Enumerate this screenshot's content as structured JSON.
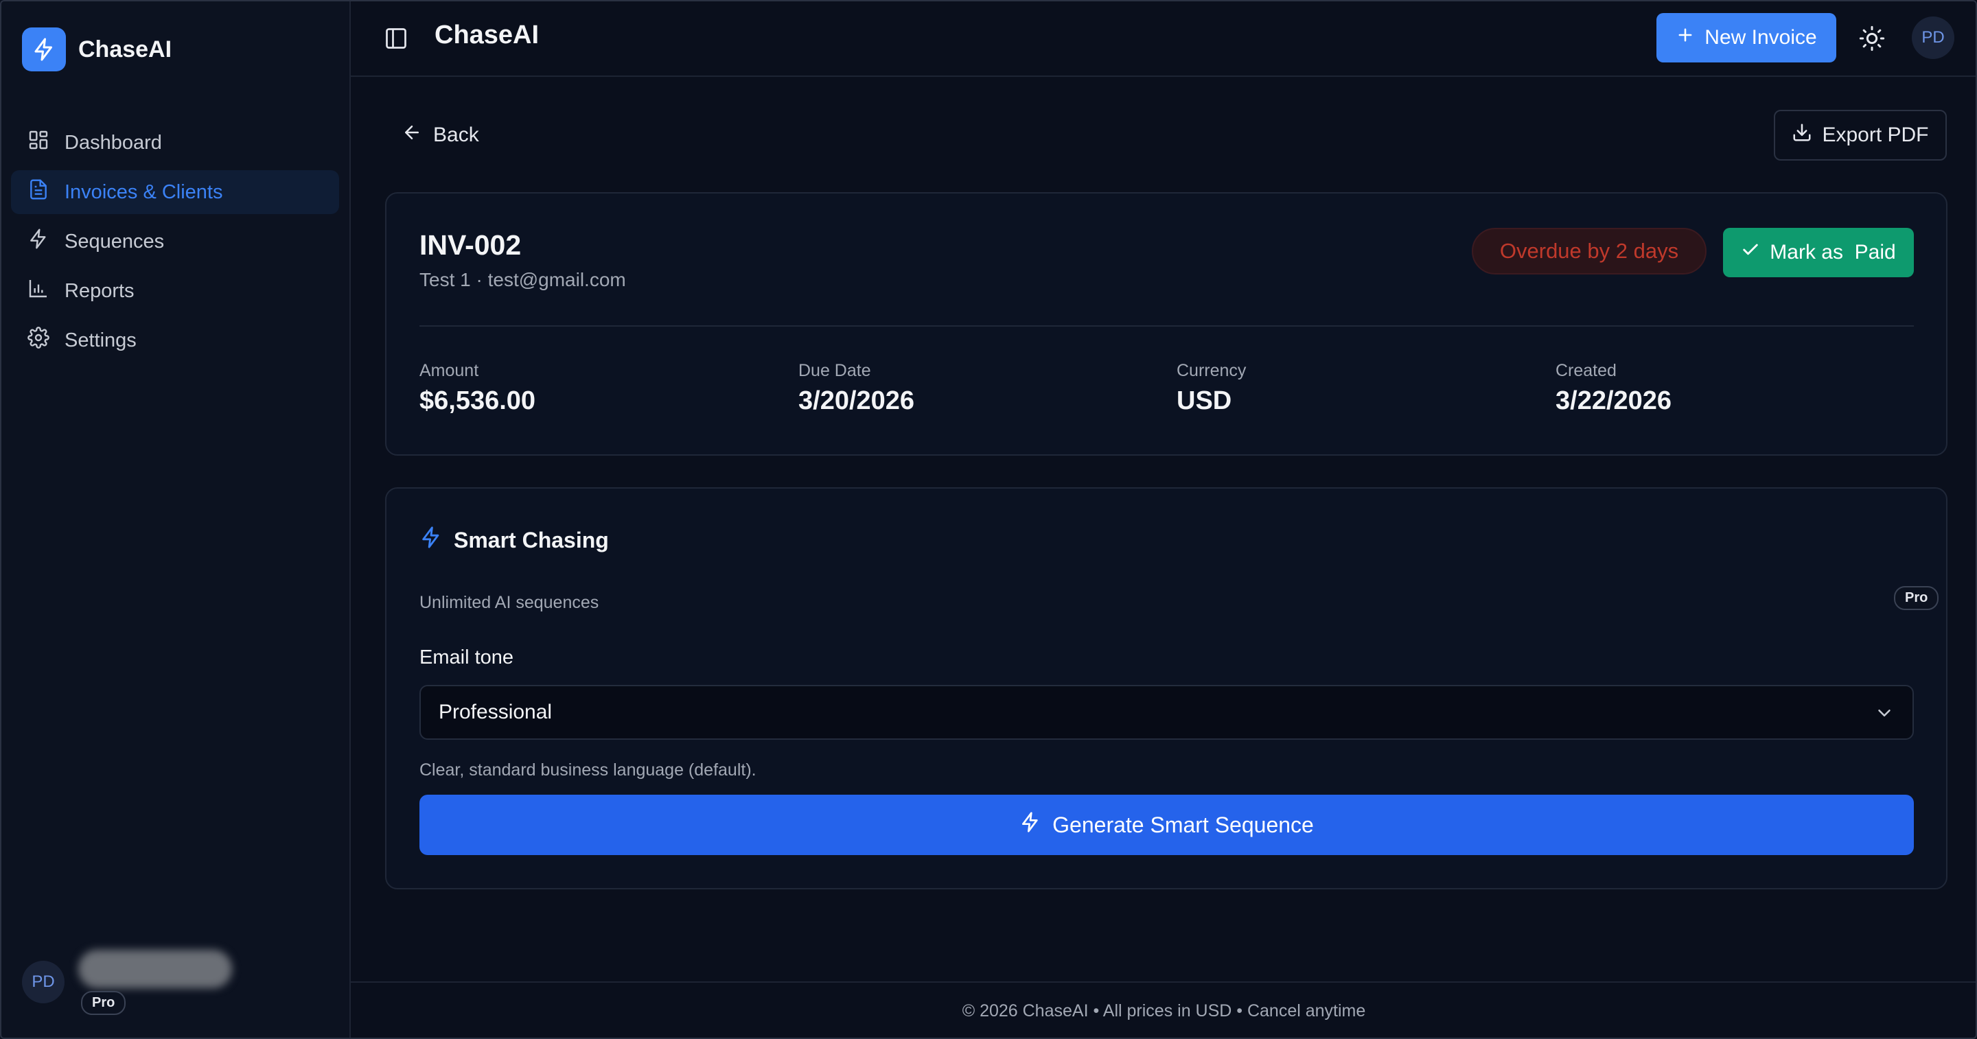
{
  "app": {
    "name": "ChaseAI"
  },
  "sidebar": {
    "items": [
      {
        "label": "Dashboard",
        "icon": "dashboard-icon",
        "active": false
      },
      {
        "label": "Invoices & Clients",
        "icon": "file-text-icon",
        "active": true
      },
      {
        "label": "Sequences",
        "icon": "bolt-icon",
        "active": false
      },
      {
        "label": "Reports",
        "icon": "bar-chart-icon",
        "active": false
      },
      {
        "label": "Settings",
        "icon": "gear-icon",
        "active": false
      }
    ],
    "user": {
      "initials": "PD",
      "plan": "Pro"
    }
  },
  "topbar": {
    "title": "ChaseAI",
    "new_invoice_label": "New Invoice",
    "avatar_initials": "PD"
  },
  "page": {
    "back_label": "Back",
    "export_label": "Export PDF"
  },
  "invoice": {
    "id": "INV-002",
    "client": "Test 1 · test@gmail.com",
    "status": "Overdue by 2 days",
    "mark_paid_label": "Mark as  Paid",
    "stats": [
      {
        "label": "Amount",
        "value": "$6,536.00"
      },
      {
        "label": "Due Date",
        "value": "3/20/2026"
      },
      {
        "label": "Currency",
        "value": "USD"
      },
      {
        "label": "Created",
        "value": "3/22/2026"
      }
    ]
  },
  "smart_chasing": {
    "title": "Smart Chasing",
    "subtitle": "Unlimited AI sequences",
    "plan_badge": "Pro",
    "tone_label": "Email tone",
    "tone_value": "Professional",
    "tone_hint": "Clear, standard business language (default).",
    "generate_label": "Generate Smart Sequence"
  },
  "footer": {
    "text": "© 2026 ChaseAI • All prices in USD • Cancel anytime"
  },
  "colors": {
    "accent": "#3b82f6",
    "primary_button": "#2563eb",
    "success": "#0e9a6e",
    "danger": "#c0392b",
    "background": "#0a0f1c"
  }
}
